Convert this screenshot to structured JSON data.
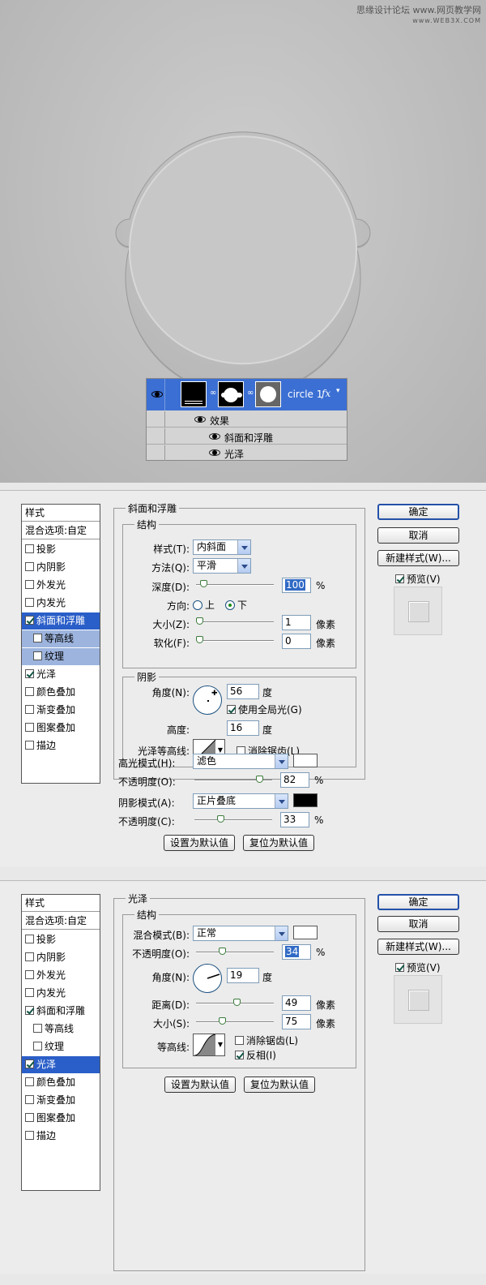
{
  "watermark": {
    "line1": "思缘设计论坛 www.网页教学网",
    "line2": "www.WEB3X.COM"
  },
  "layers_panel": {
    "layer_name": "circle 1",
    "fx_label": "fx",
    "effects_label": "效果",
    "effect_items": [
      "斜面和浮雕",
      "光泽"
    ]
  },
  "style_list": {
    "header": "样式",
    "blend_options": "混合选项:自定",
    "items": [
      "投影",
      "内阴影",
      "外发光",
      "内发光",
      "斜面和浮雕",
      "等高线",
      "纹理",
      "光泽",
      "颜色叠加",
      "渐变叠加",
      "图案叠加",
      "描边"
    ]
  },
  "buttons": {
    "ok": "确定",
    "cancel": "取消",
    "new_style": "新建样式(W)...",
    "preview": "预览(V)",
    "set_default": "设置为默认值",
    "reset_default": "复位为默认值"
  },
  "bevel": {
    "title": "斜面和浮雕",
    "structure_title": "结构",
    "style_label": "样式(T):",
    "style_value": "内斜面",
    "technique_label": "方法(Q):",
    "technique_value": "平滑",
    "depth_label": "深度(D):",
    "depth_value": "100",
    "depth_unit": "%",
    "direction_label": "方向:",
    "direction_up": "上",
    "direction_down": "下",
    "size_label": "大小(Z):",
    "size_value": "1",
    "size_unit": "像素",
    "soften_label": "软化(F):",
    "soften_value": "0",
    "soften_unit": "像素",
    "shading_title": "阴影",
    "angle_label": "角度(N):",
    "angle_value": "56",
    "angle_unit": "度",
    "global_light": "使用全局光(G)",
    "altitude_label": "高度:",
    "altitude_value": "16",
    "altitude_unit": "度",
    "gloss_label": "光泽等高线:",
    "anti_alias": "消除锯齿(L)",
    "highlight_mode_label": "高光模式(H):",
    "highlight_mode_value": "滤色",
    "highlight_opacity_label": "不透明度(O):",
    "highlight_opacity_value": "82",
    "highlight_opacity_unit": "%",
    "shadow_mode_label": "阴影模式(A):",
    "shadow_mode_value": "正片叠底",
    "shadow_opacity_label": "不透明度(C):",
    "shadow_opacity_value": "33",
    "shadow_opacity_unit": "%",
    "highlight_color": "#ffffff",
    "shadow_color": "#000000"
  },
  "satin": {
    "title": "光泽",
    "structure_title": "结构",
    "blend_label": "混合模式(B):",
    "blend_value": "正常",
    "opacity_label": "不透明度(O):",
    "opacity_value": "34",
    "opacity_unit": "%",
    "angle_label": "角度(N):",
    "angle_value": "19",
    "angle_unit": "度",
    "distance_label": "距离(D):",
    "distance_value": "49",
    "distance_unit": "像素",
    "size_label": "大小(S):",
    "size_value": "75",
    "size_unit": "像素",
    "contour_label": "等高线:",
    "anti_alias": "消除锯齿(L)",
    "invert": "反相(I)",
    "color": "#ffffff"
  },
  "colors": {
    "accent": "#2a5ec8",
    "selected_layer": "#3b6fd3"
  }
}
